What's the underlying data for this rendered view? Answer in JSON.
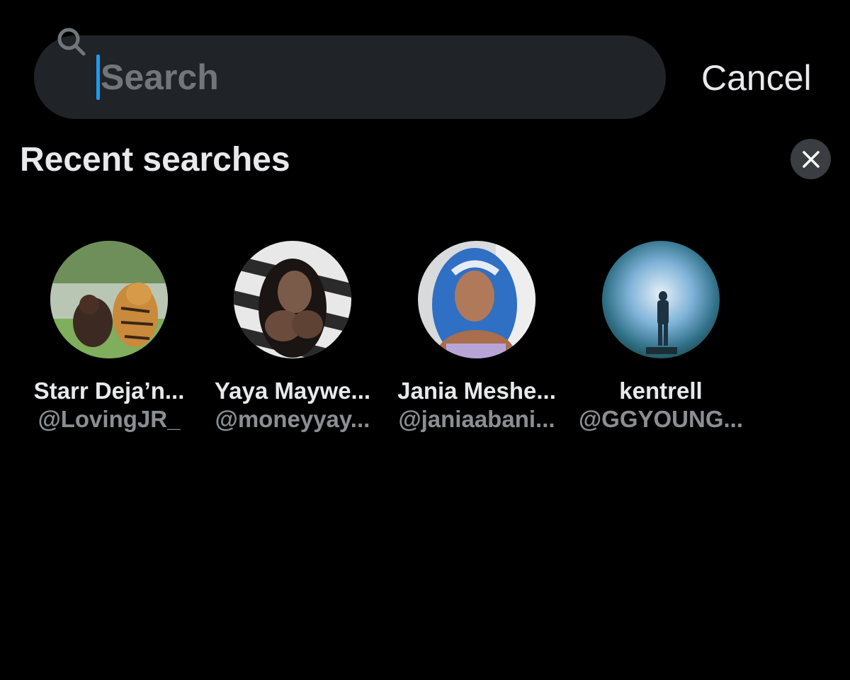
{
  "search": {
    "placeholder": "Search",
    "value": "",
    "cancel_label": "Cancel"
  },
  "recent": {
    "title": "Recent searches",
    "clear_icon": "close-icon",
    "users": [
      {
        "name": "Starr Deja’n...",
        "handle": "@LovingJR_"
      },
      {
        "name": "Yaya Maywe...",
        "handle": "@moneyyay..."
      },
      {
        "name": "Jania Meshe...",
        "handle": "@janiaabani..."
      },
      {
        "name": "kentrell",
        "handle": "@GGYOUNG..."
      }
    ]
  },
  "colors": {
    "background": "#000000",
    "search_field": "#202327",
    "caret": "#1d9bf0",
    "primary_text": "#e7e9ea",
    "secondary_text": "#8b8f94",
    "clear_button": "#3a3d41"
  }
}
